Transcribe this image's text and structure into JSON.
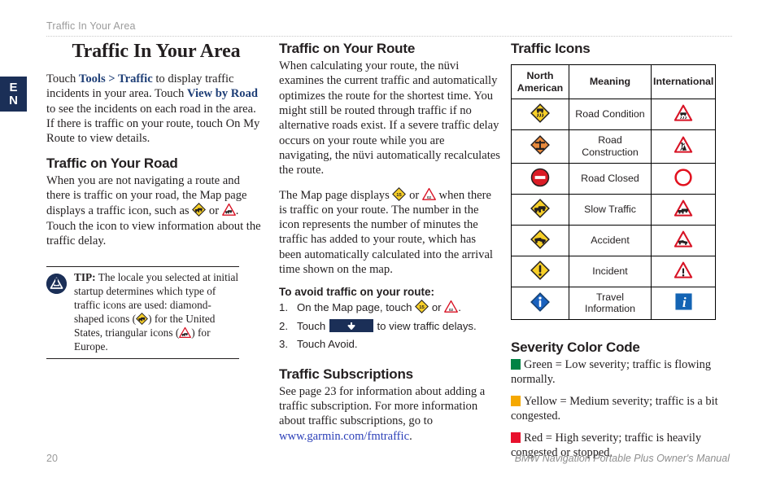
{
  "header": {
    "running_head": "Traffic In Your Area"
  },
  "lang_tab": {
    "line1": "E",
    "line2": "N"
  },
  "page_title": "Traffic In Your Area",
  "col1": {
    "intro_p1": "Touch ",
    "intro_tools": "Tools > Traffic",
    "intro_p2": " to display traffic incidents in your area. Touch ",
    "intro_view": "View by Road",
    "intro_p3": " to see the incidents on each road in the area. If there is traffic on your route, touch On My Route to view details.",
    "road_heading": "Traffic on Your Road",
    "road_p1": "When you are not navigating a route and there is traffic on your road, the Map page displays a traffic icon, such as ",
    "road_p2": " or ",
    "road_p3": ". Touch the icon to view information about the traffic delay.",
    "tip_label": "TIP:",
    "tip_t1": " The locale you selected at initial startup determines which type of traffic icons are used: diamond-shaped icons (",
    "tip_t2": ") for the United States, triangular icons (",
    "tip_t3": ") for Europe."
  },
  "col2": {
    "route_heading": "Traffic on Your Route",
    "route_p1": "When calculating your route, the nüvi examines the current traffic and automatically optimizes the route for the shortest time. You might still be routed through traffic if no alternative roads exist. If a severe traffic delay occurs on your route while you are navigating, the nüvi automatically recalculates the route.",
    "route_p2a": "The Map page displays ",
    "route_p2b": " or ",
    "route_p2c": " when there is traffic on your route. The number in the icon represents the number of minutes the traffic has added to your route, which has been automatically calculated into the arrival time shown on the map.",
    "avoid_heading": "To avoid traffic on your route:",
    "step1_num": "1.",
    "step1_a": "On the Map page, touch ",
    "step1_b": " or ",
    "step1_c": ".",
    "step2_num": "2.",
    "step2_a": "Touch ",
    "step2_b": " to view traffic delays.",
    "step3_num": "3.",
    "step3_text": "Touch Avoid.",
    "subs_heading": "Traffic Subscriptions",
    "subs_p1": "See page 23 for information about adding a traffic subscription. For more information about traffic subscriptions, go to ",
    "subs_link": "www.garmin.com/fmtraffic",
    "subs_p2": "."
  },
  "col3": {
    "icons_heading": "Traffic Icons",
    "table": {
      "headers": [
        "North American",
        "Meaning",
        "International"
      ],
      "rows": [
        {
          "meaning": "Road Condition",
          "na_icon": "diamond-road-condition-icon",
          "intl_icon": "triangle-road-condition-icon"
        },
        {
          "meaning": "Road Construction",
          "na_icon": "diamond-road-construction-icon",
          "intl_icon": "triangle-road-construction-icon"
        },
        {
          "meaning": "Road Closed",
          "na_icon": "no-entry-icon",
          "intl_icon": "circle-road-closed-icon"
        },
        {
          "meaning": "Slow Traffic",
          "na_icon": "diamond-slow-traffic-icon",
          "intl_icon": "triangle-slow-traffic-icon"
        },
        {
          "meaning": "Accident",
          "na_icon": "diamond-accident-icon",
          "intl_icon": "triangle-accident-icon"
        },
        {
          "meaning": "Incident",
          "na_icon": "diamond-incident-icon",
          "intl_icon": "triangle-incident-icon"
        },
        {
          "meaning": "Travel Information",
          "na_icon": "diamond-info-icon",
          "intl_icon": "square-info-icon"
        }
      ]
    },
    "severity_heading": "Severity Color Code",
    "severity": [
      {
        "color": "#008345",
        "text": "Green = Low severity; traffic is flowing normally."
      },
      {
        "color": "#f5a800",
        "text": "Yellow = Medium severity; traffic is a bit congested."
      },
      {
        "color": "#e8112d",
        "text": "Red = High severity; traffic is heavily congested or stopped."
      }
    ]
  },
  "footer": {
    "page_number": "20",
    "manual_title": "BMW Navigation Portable Plus Owner's Manual"
  },
  "colors": {
    "navy": "#1b2f57",
    "link_blue": "#2b3fb8",
    "bold_blue": "#1f3f77",
    "rule_gray": "#c9c9c9"
  }
}
